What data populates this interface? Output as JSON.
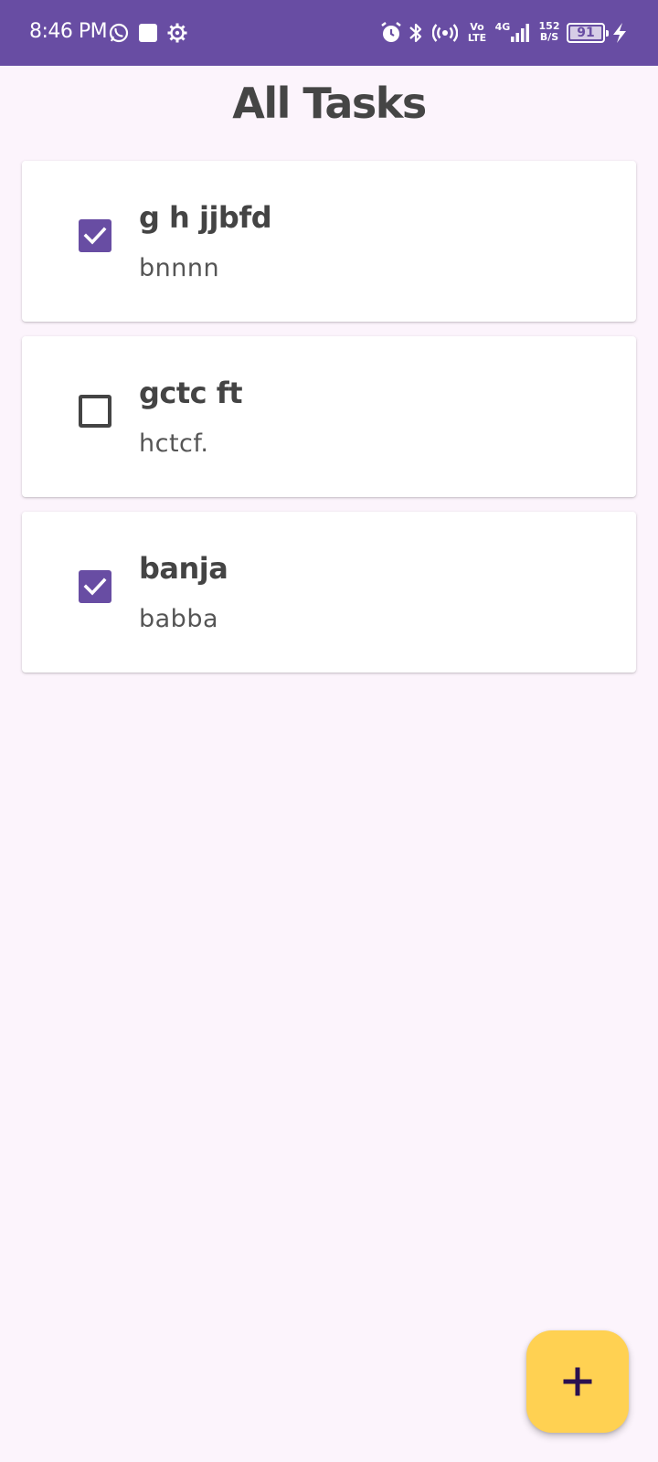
{
  "status_bar": {
    "time": "8:46 PM",
    "left_icons": [
      "whatsapp-icon",
      "square-app-icon",
      "settings-gear-icon"
    ],
    "right_icons": [
      "alarm-icon",
      "bluetooth-icon",
      "hotspot-icon",
      "volte-icon",
      "signal-4g-icon",
      "network-speed",
      "battery-icon",
      "charging-icon"
    ],
    "volte_top": "Vo",
    "volte_bottom": "LTE",
    "network_type": "4G",
    "speed_value": "152",
    "speed_unit": "B/S",
    "battery_level": "91",
    "bar_color": "#684da3"
  },
  "page": {
    "title": "All Tasks"
  },
  "tasks": [
    {
      "title": "g h jjbfd",
      "description": "bnnnn",
      "completed": true
    },
    {
      "title": "gctc ft",
      "description": "hctcf.",
      "completed": false
    },
    {
      "title": "banja",
      "description": "babba",
      "completed": true
    }
  ],
  "fab": {
    "icon": "plus-icon",
    "color": "#ffd152"
  },
  "colors": {
    "accent": "#684da3",
    "background": "#fcf4fc"
  }
}
